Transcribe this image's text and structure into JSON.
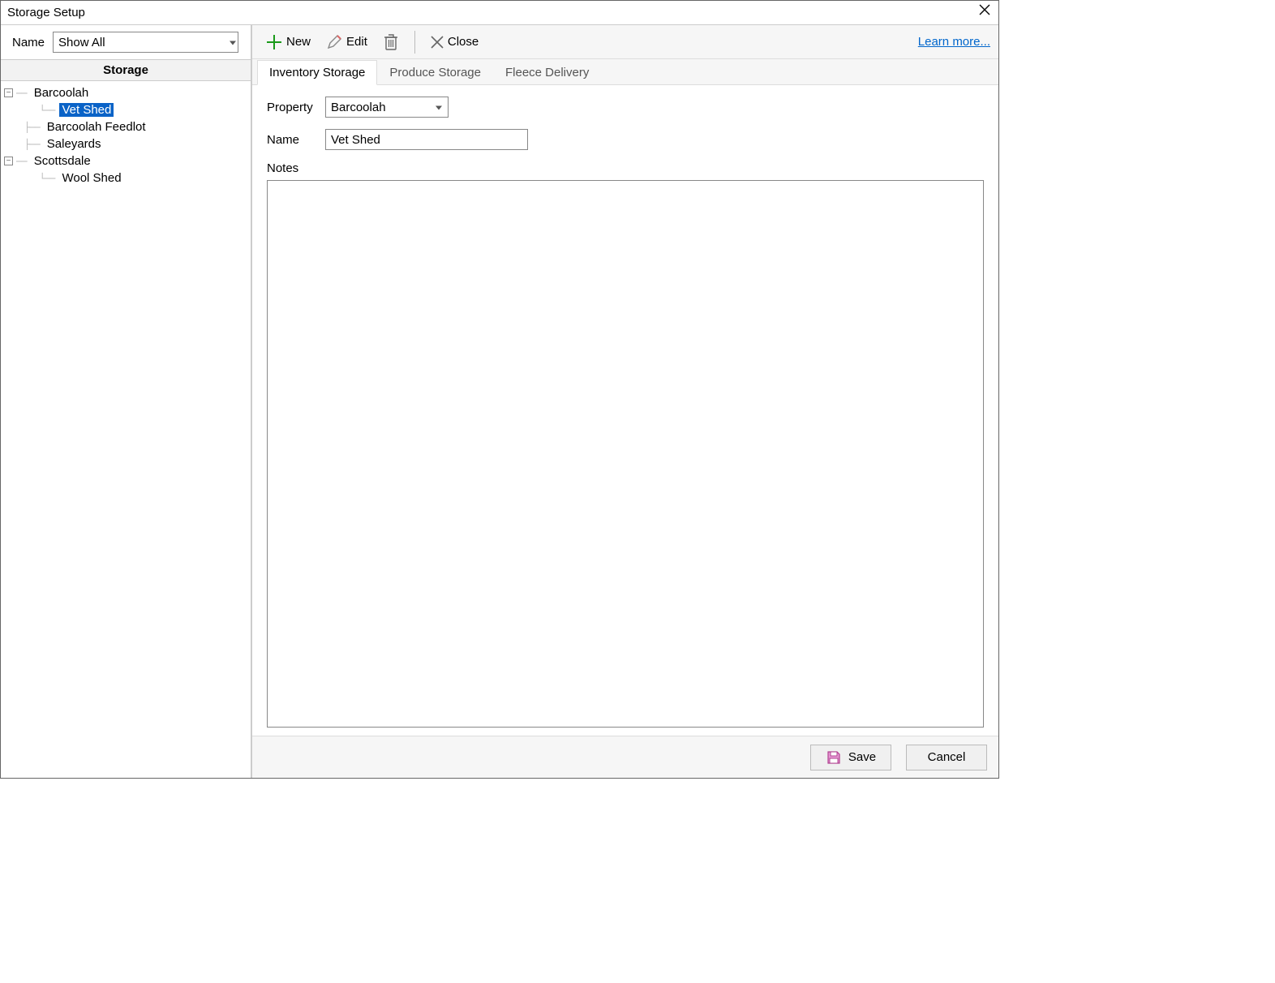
{
  "window": {
    "title": "Storage Setup"
  },
  "filter": {
    "label": "Name",
    "value": "Show All"
  },
  "tree": {
    "header": "Storage",
    "nodes": {
      "barcoolah": "Barcoolah",
      "vet_shed": "Vet Shed",
      "barcoolah_feedlot": "Barcoolah Feedlot",
      "saleyards": "Saleyards",
      "scottsdale": "Scottsdale",
      "wool_shed": "Wool Shed"
    }
  },
  "toolbar": {
    "new": "New",
    "edit": "Edit",
    "close": "Close",
    "learn_more": "Learn more..."
  },
  "tabs": {
    "inventory": "Inventory Storage",
    "produce": "Produce Storage",
    "fleece": "Fleece Delivery"
  },
  "form": {
    "property_label": "Property",
    "property_value": "Barcoolah",
    "name_label": "Name",
    "name_value": "Vet Shed",
    "notes_label": "Notes",
    "notes_value": ""
  },
  "footer": {
    "save": "Save",
    "cancel": "Cancel"
  }
}
